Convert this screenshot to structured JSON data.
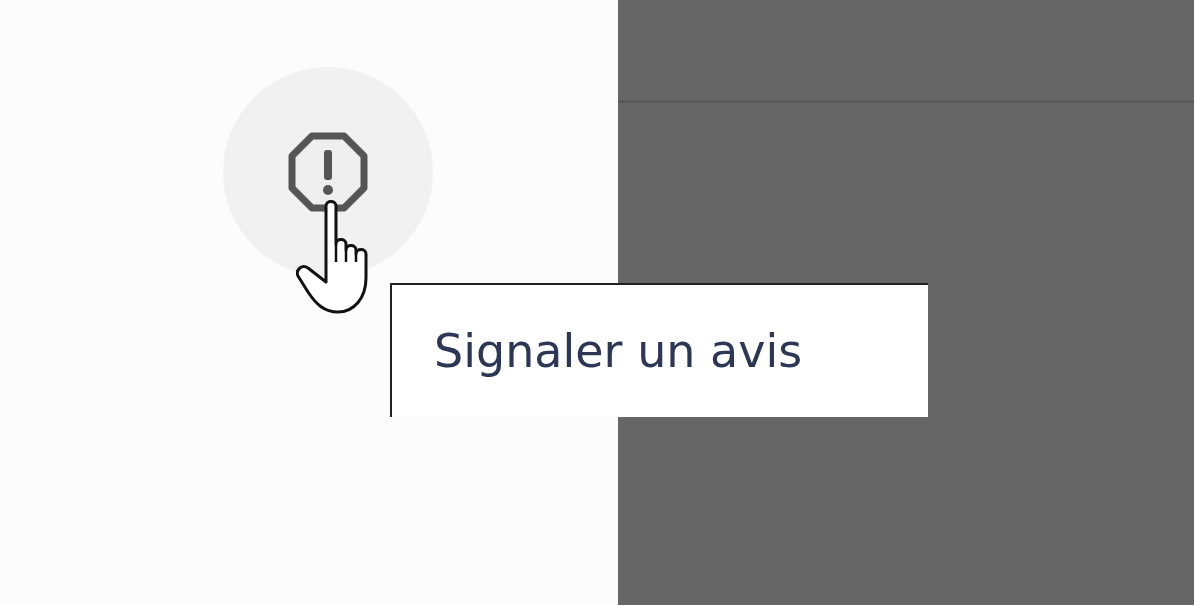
{
  "report_button": {
    "tooltip": "Signaler un avis"
  }
}
